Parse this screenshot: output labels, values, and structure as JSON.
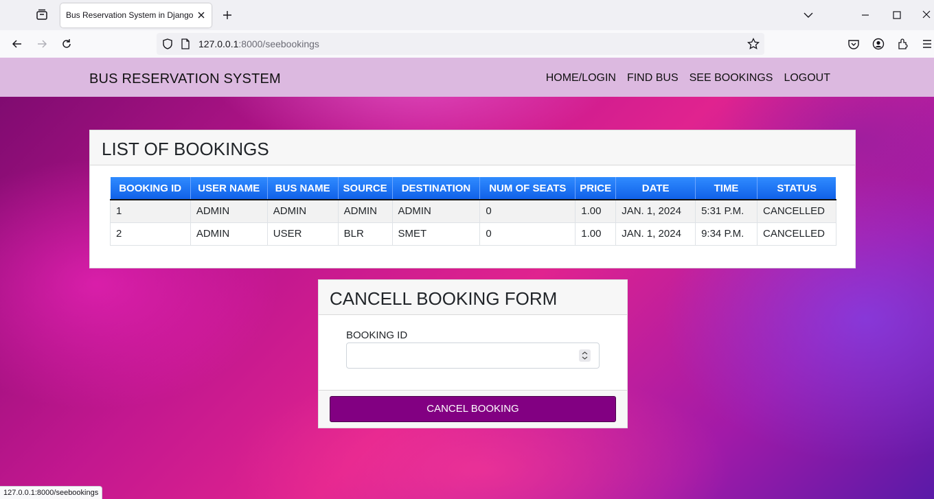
{
  "browser": {
    "tab_title": "Bus Reservation System in Django F",
    "url_host": "127.0.0.1",
    "url_rest": ":8000/seebookings",
    "status_url": "127.0.0.1:8000/seebookings"
  },
  "header": {
    "brand": "BUS RESERVATION SYSTEM",
    "nav": [
      "HOME/LOGIN",
      "FIND BUS",
      "SEE BOOKINGS",
      "LOGOUT"
    ]
  },
  "bookings": {
    "title": "LIST OF BOOKINGS",
    "columns": [
      "BOOKING ID",
      "USER NAME",
      "BUS NAME",
      "SOURCE",
      "DESTINATION",
      "NUM OF SEATS",
      "PRICE",
      "DATE",
      "TIME",
      "STATUS"
    ],
    "rows": [
      [
        "1",
        "ADMIN",
        "ADMIN",
        "ADMIN",
        "ADMIN",
        "0",
        "1.00",
        "JAN. 1, 2024",
        "5:31 P.M.",
        "CANCELLED"
      ],
      [
        "2",
        "ADMIN",
        "USER",
        "BLR",
        "SMET",
        "0",
        "1.00",
        "JAN. 1, 2024",
        "9:34 P.M.",
        "CANCELLED"
      ]
    ]
  },
  "cancel_form": {
    "title": "CANCELL BOOKING FORM",
    "field_label": "BOOKING ID",
    "field_value": "",
    "button_label": "CANCEL BOOKING"
  },
  "colors": {
    "header_bg": "#dcb9e0",
    "table_header": "#1a6ff0",
    "button": "#820082"
  },
  "icons": [
    "tab-list-icon",
    "close-icon",
    "plus-icon",
    "chevron-down-icon",
    "minimize-icon",
    "maximize-icon",
    "window-close-icon",
    "back-icon",
    "forward-icon",
    "reload-icon",
    "shield-icon",
    "page-icon",
    "star-icon",
    "pocket-icon",
    "account-icon",
    "extensions-icon",
    "menu-icon"
  ]
}
